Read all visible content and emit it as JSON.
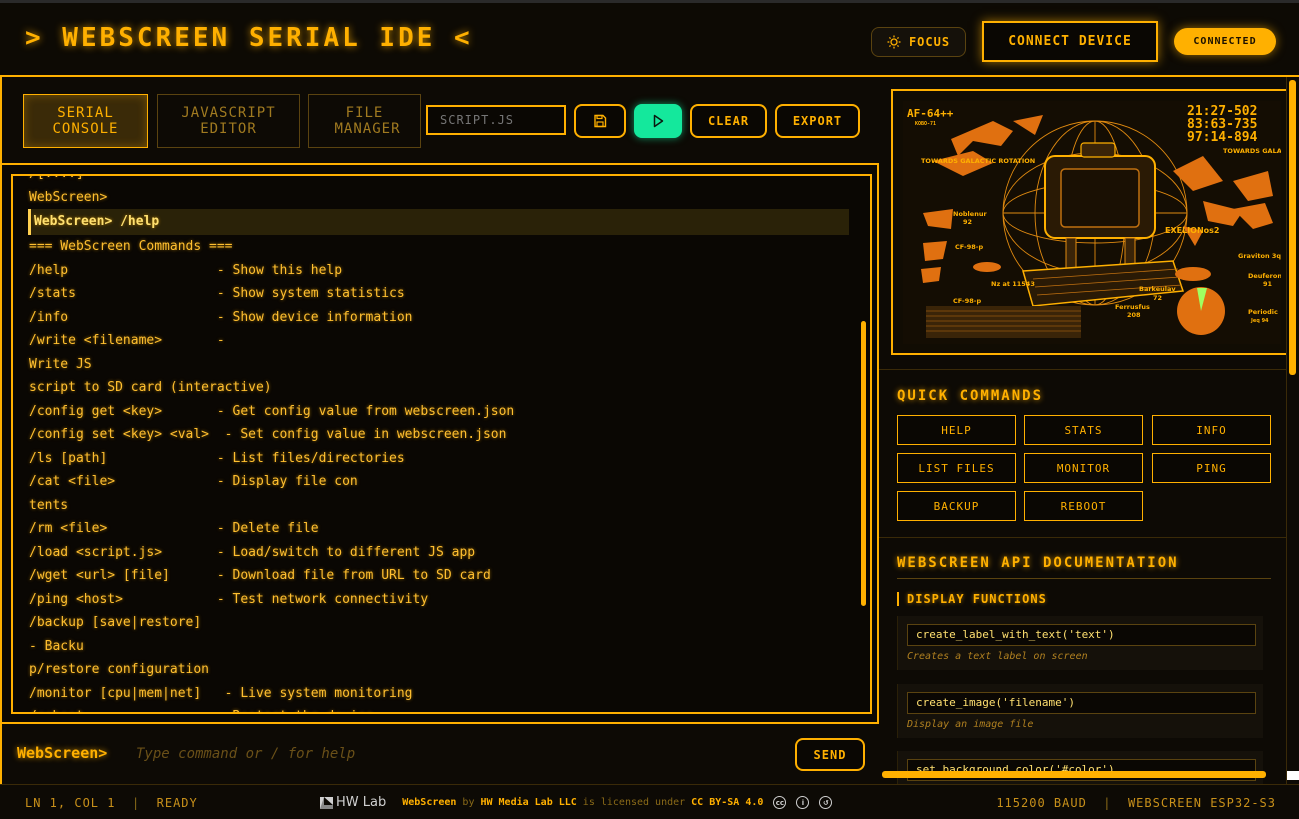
{
  "header": {
    "title": "> WEBSCREEN SERIAL IDE <",
    "focus_label": "FOCUS",
    "connect_label": "CONNECT DEVICE",
    "status": "CONNECTED"
  },
  "tabs": [
    {
      "label": "SERIAL CONSOLE",
      "active": true
    },
    {
      "label": "JAVASCRIPT EDITOR",
      "active": false
    },
    {
      "label": "FILE MANAGER",
      "active": false
    }
  ],
  "toolbar": {
    "filename_placeholder": "SCRIPT.JS",
    "clear_label": "CLEAR",
    "export_label": "EXPORT"
  },
  "console": {
    "lines": [
      "/[....]",
      "WebScreen>",
      "WebScreen> /help",
      "=== WebScreen Commands ===",
      "/help                   - Show this help",
      "/stats                  - Show system statistics",
      "/info                   - Show device information",
      "/write <filename>       -",
      "Write JS",
      "script to SD card (interactive)",
      "/config get <key>       - Get config value from webscreen.json",
      "/config set <key> <val>  - Set config value in webscreen.json",
      "/ls [path]              - List files/directories",
      "/cat <file>             - Display file con",
      "tents",
      "/rm <file>              - Delete file",
      "/load <script.js>       - Load/switch to different JS app",
      "/wget <url> [file]      - Download file from URL to SD card",
      "/ping <host>            - Test network connectivity",
      "/backup [save|restore]",
      "- Backu",
      "p/restore configuration",
      "/monitor [cpu|mem|net]   - Live system monitoring",
      "/reboot                 - Restart the device"
    ],
    "highlight_index": 2
  },
  "input": {
    "prompt": "WebScreen>",
    "placeholder": "Type command or / for help",
    "send_label": "SEND"
  },
  "screen": {
    "top_left": "AF-64++",
    "top_left_sub": "KOBO-71",
    "clock": [
      "21:27-502",
      "83:63-735",
      "97:14-894"
    ],
    "labels": [
      "TOWARDS GALACTIC ROTATION",
      "TOWARDS GALACTIC CENTRIC",
      "Noblenur",
      "92",
      "EXELIONos2",
      "CF-98-p",
      "Nz at 11543",
      "Graviton 3q",
      "Deuferon",
      "91",
      "Barkeulav",
      "72",
      "CF-98-p",
      "Ferrusfus",
      "208",
      "Periodic",
      "Jeq 94"
    ]
  },
  "quick_commands": {
    "title": "QUICK COMMANDS",
    "buttons": [
      "HELP",
      "STATS",
      "INFO",
      "LIST FILES",
      "MONITOR",
      "PING",
      "BACKUP",
      "REBOOT"
    ]
  },
  "api_docs": {
    "title": "WEBSCREEN API DOCUMENTATION",
    "section": "DISPLAY FUNCTIONS",
    "items": [
      {
        "code": "create_label_with_text('text')",
        "desc": "Creates a text label on screen"
      },
      {
        "code": "create_image('filename')",
        "desc": "Display an image file"
      },
      {
        "code": "set_background_color('#color')",
        "desc": ""
      }
    ]
  },
  "footer": {
    "position": "LN 1, COL 1",
    "state": "READY",
    "hw_logo": "HW Lab",
    "license_product": "WebScreen",
    "license_by": "by",
    "license_org": "HW Media Lab LLC",
    "license_mid": "is licensed under",
    "license_name": "CC BY-SA 4.0",
    "baud": "115200 BAUD",
    "device": "WEBSCREEN ESP32-S3"
  },
  "colors": {
    "accent": "#ffb000",
    "run": "#14e89c",
    "background": "#0b0803"
  }
}
